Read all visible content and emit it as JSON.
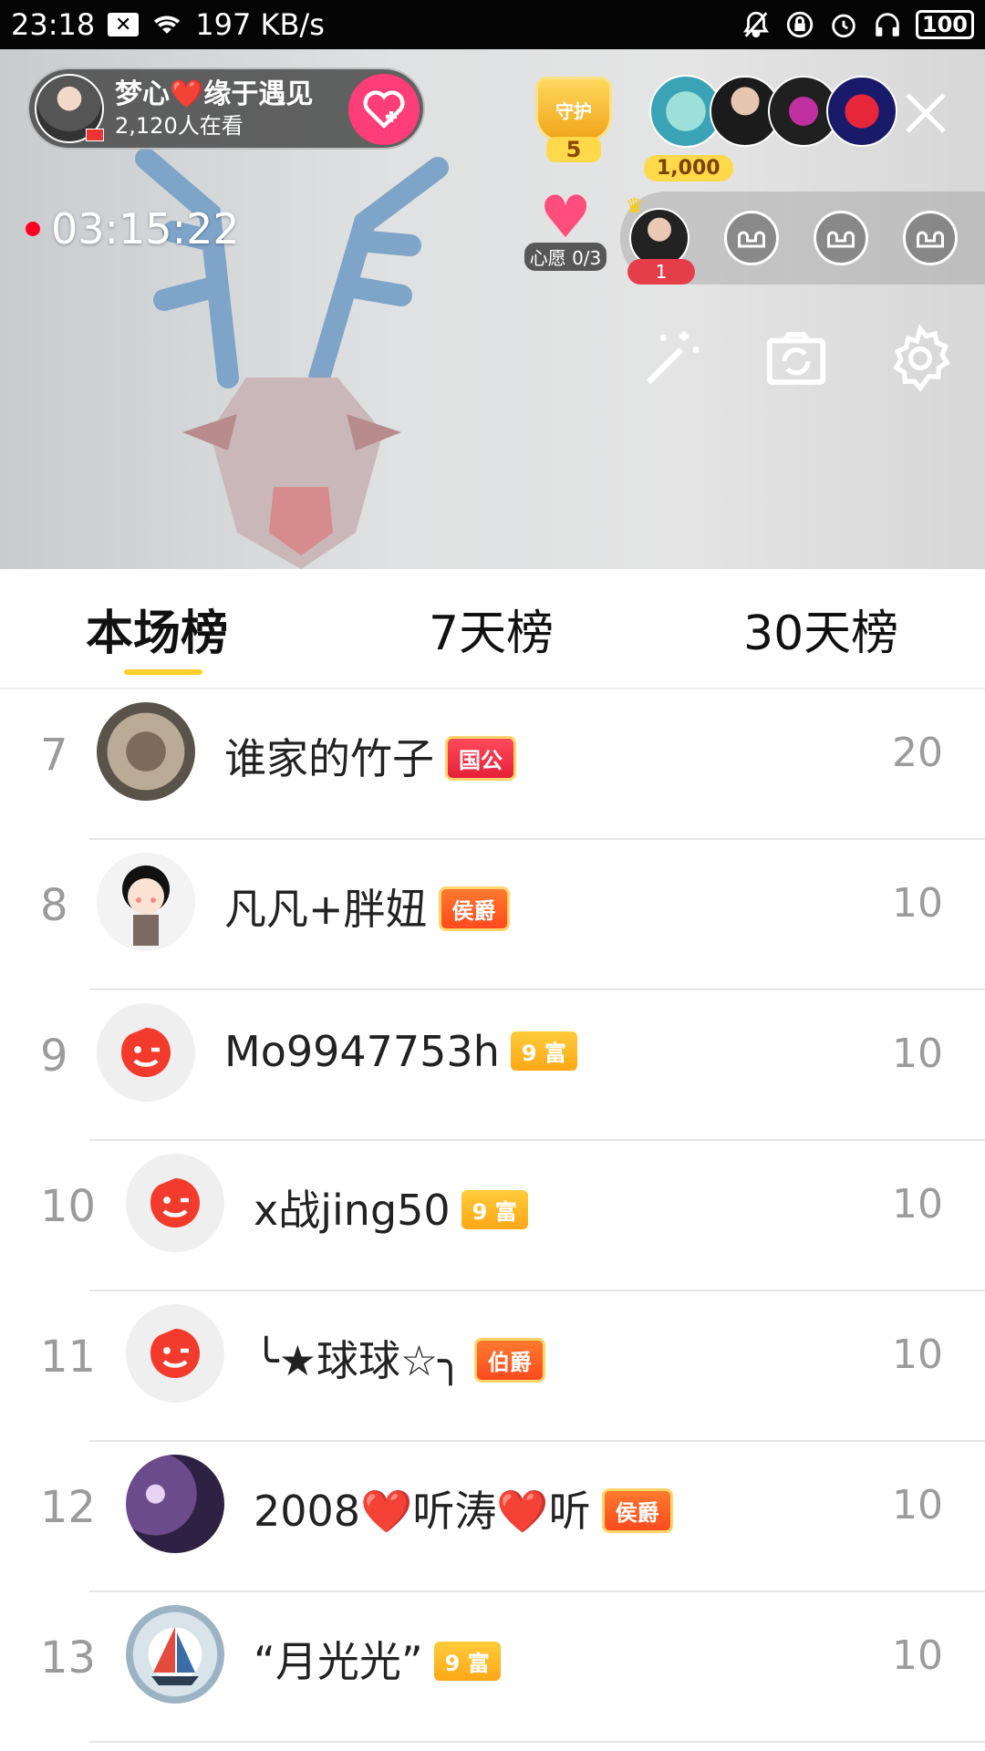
{
  "status_bar": {
    "time": "23:18",
    "speed": "197 KB/s",
    "battery": "100",
    "icons": [
      "close-notification-icon",
      "wifi-icon",
      "mute-bell-icon",
      "lock-rotation-icon",
      "alarm-icon",
      "headphones-icon",
      "battery-icon"
    ]
  },
  "live": {
    "host_name": "梦心❤️缘于遇见",
    "viewers_text": "2,120人在看",
    "guard_label": "守护",
    "guard_count": "5",
    "contribution": "1,000",
    "timer": "03:15:22",
    "wish_label": "心愿 0/3",
    "mic_number": "1"
  },
  "tabs": [
    {
      "label": "本场榜",
      "active": true
    },
    {
      "label": "7天榜",
      "active": false
    },
    {
      "label": "30天榜",
      "active": false
    }
  ],
  "ranking": [
    {
      "rank": "7",
      "name": "谁家的竹子",
      "badge": "国公",
      "badge_type": "noble-red",
      "score": "20",
      "avatar": "bird-photo"
    },
    {
      "rank": "8",
      "name": "凡凡+胖妞",
      "badge": "侯爵",
      "badge_type": "noble",
      "score": "10",
      "avatar": "cartoon-girl"
    },
    {
      "rank": "9",
      "name": "Mo9947753h",
      "badge": "9 富",
      "badge_type": "rich",
      "score": "10",
      "avatar": "default-face"
    },
    {
      "rank": "10",
      "name": "x战jing50",
      "badge": "9 富",
      "badge_type": "rich",
      "score": "10",
      "avatar": "default-face"
    },
    {
      "rank": "11",
      "name": "╰★球球☆╮",
      "badge": "伯爵",
      "badge_type": "noble",
      "score": "10",
      "avatar": "default-face"
    },
    {
      "rank": "12",
      "name": "2008❤️听涛❤️听",
      "badge": "侯爵",
      "badge_type": "noble",
      "score": "10",
      "avatar": "storm-photo"
    },
    {
      "rank": "13",
      "name": "“月光光”",
      "badge": "9 富",
      "badge_type": "rich",
      "score": "10",
      "avatar": "sailboat-stone"
    }
  ],
  "colors": {
    "accent_yellow": "#ffcf2a",
    "follow_pink": "#ff3d78",
    "rank_gray": "#9b9b9b",
    "default_avatar_red": "#f23b2c"
  }
}
